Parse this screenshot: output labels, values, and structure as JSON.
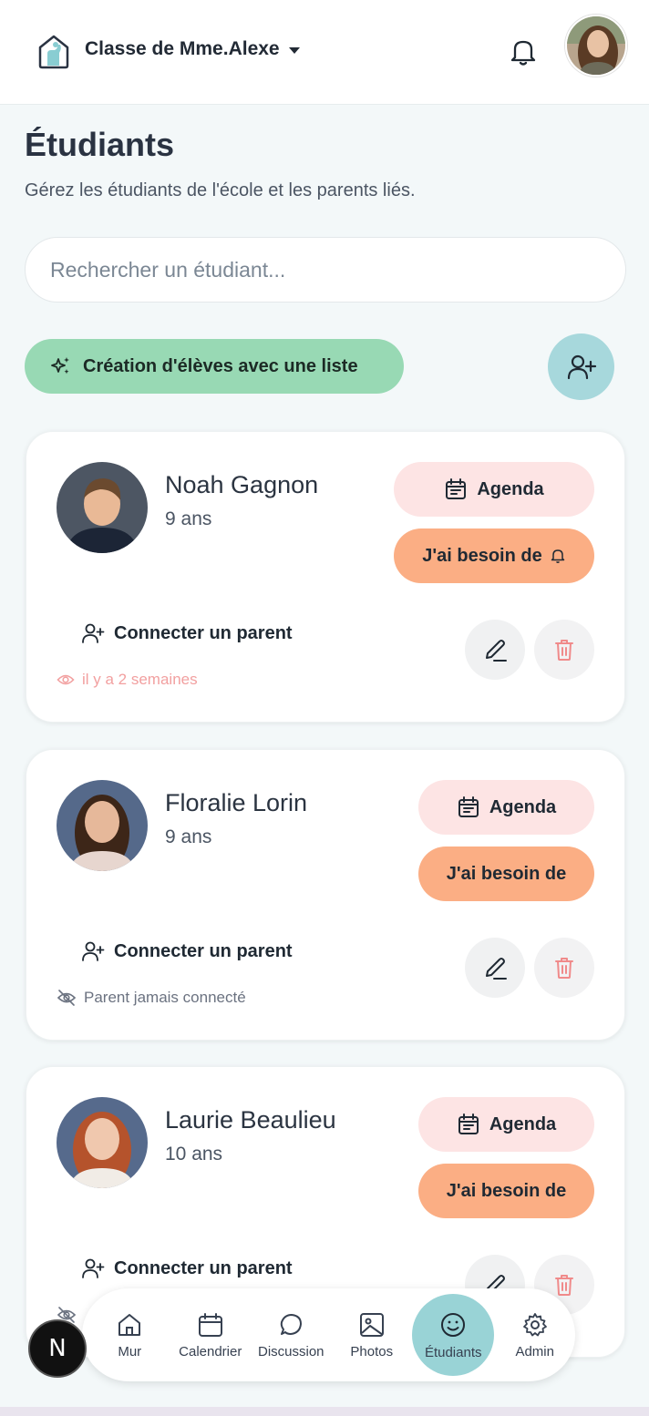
{
  "header": {
    "class_name": "Classe de Mme.Alexe",
    "logo_icon": "house-hand-icon",
    "notification_icon": "bell-icon"
  },
  "page": {
    "title": "Étudiants",
    "subtitle": "Gérez les étudiants de l'école et les parents liés."
  },
  "search": {
    "placeholder": "Rechercher un étudiant..."
  },
  "actions": {
    "bulk_create_label": "Création d'élèves avec une liste",
    "add_student_icon": "user-plus-icon"
  },
  "students": [
    {
      "name": "Noah Gagnon",
      "age": "9 ans",
      "agenda_label": "Agenda",
      "need_label": "J'ai besoin de",
      "connect_label": "Connecter un parent",
      "status": "il y a 2 semaines",
      "status_icon": "eye-icon"
    },
    {
      "name": "Floralie Lorin",
      "age": "9 ans",
      "agenda_label": "Agenda",
      "need_label": "J'ai besoin de",
      "connect_label": "Connecter un parent",
      "status": "Parent jamais connecté",
      "status_icon": "eye-off-icon"
    },
    {
      "name": "Laurie Beaulieu",
      "age": "10 ans",
      "agenda_label": "Agenda",
      "need_label": "J'ai besoin de",
      "connect_label": "Connecter un parent",
      "status": "",
      "status_icon": "eye-off-icon"
    }
  ],
  "nav": {
    "items": [
      {
        "label": "Mur",
        "icon": "home-icon"
      },
      {
        "label": "Calendrier",
        "icon": "calendar-icon"
      },
      {
        "label": "Discussion",
        "icon": "chat-icon"
      },
      {
        "label": "Photos",
        "icon": "image-icon"
      },
      {
        "label": "Étudiants",
        "icon": "smile-icon",
        "active": true
      },
      {
        "label": "Admin",
        "icon": "gear-icon"
      }
    ]
  },
  "badge": {
    "letter": "N"
  },
  "colors": {
    "primary_green": "#98d9b4",
    "accent_teal": "#a7d8dc",
    "agenda_pink": "#fde4e4",
    "need_orange": "#fbae84",
    "delete_red": "#f08a8a"
  }
}
